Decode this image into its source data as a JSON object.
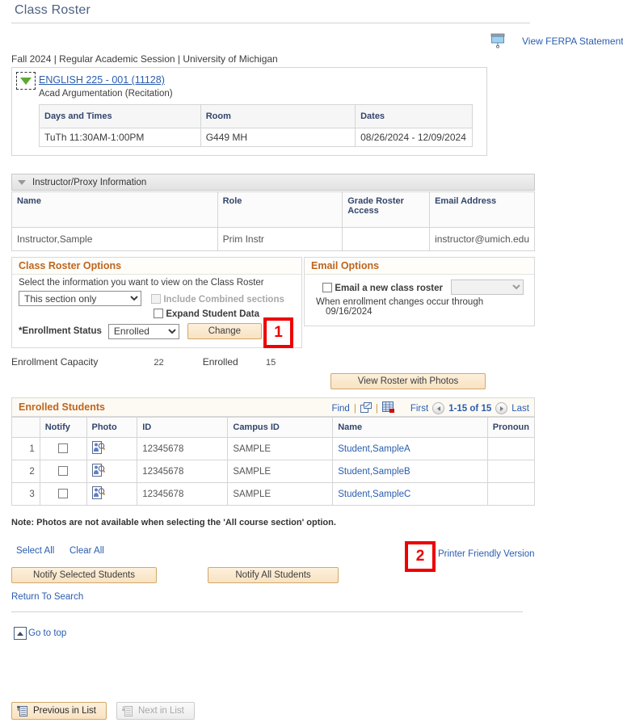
{
  "page": {
    "title": "Class Roster"
  },
  "ferpa": {
    "icon": "projector-screen-icon",
    "link_label": "View FERPA Statement"
  },
  "term_line": "Fall 2024 | Regular Academic Session | University of Michigan",
  "class": {
    "expand_icon": "collapse-triangle-icon",
    "link": "ENGLISH 225 - 001 (11128)",
    "subtitle": "Acad Argumentation (Recitation)",
    "meeting_headers": [
      "Days and Times",
      "Room",
      "Dates"
    ],
    "meeting_row": [
      "TuTh 11:30AM-1:00PM",
      "G449 MH",
      "08/26/2024 - 12/09/2024"
    ]
  },
  "instructor_section": {
    "header": "Instructor/Proxy Information",
    "columns": [
      "Name",
      "Role",
      "Grade Roster Access",
      "Email Address"
    ],
    "column_grade_line1": "Grade Roster",
    "column_grade_line2": "Access",
    "rows": [
      {
        "name": "Instructor,Sample",
        "role": "Prim Instr",
        "grade_roster_access": "",
        "email": "instructor@umich.edu"
      }
    ]
  },
  "roster_options": {
    "header": "Class Roster Options",
    "instruction": "Select the information you want to view on the Class Roster",
    "section_select_value": "This section only",
    "section_select_options": [
      "This section only"
    ],
    "include_combined_label": "Include Combined sections",
    "include_combined_checked": false,
    "include_combined_disabled": true,
    "expand_student_data_label": "Expand Student Data",
    "expand_student_data_checked": false,
    "enrollment_status_label": "*Enrollment Status",
    "enrollment_status_value": "Enrolled",
    "enrollment_status_options": [
      "Enrolled"
    ],
    "change_button": "Change"
  },
  "email_options": {
    "header": "Email Options",
    "checkbox_label": "Email a new class roster",
    "checkbox_checked": false,
    "select_value": "",
    "note_line1": "When enrollment changes occur through",
    "note_line2": "09/16/2024"
  },
  "enrollment": {
    "capacity_label": "Enrollment Capacity",
    "capacity_value": "22",
    "enrolled_label": "Enrolled",
    "enrolled_value": "15",
    "view_photos_button": "View Roster with Photos"
  },
  "students_grid": {
    "title": "Enrolled Students",
    "find_label": "Find",
    "view_all_icon": "open-new-window-icon",
    "download_icon": "download-to-excel-grid-icon",
    "first_label": "First",
    "prev_icon": "previous-arrow-icon",
    "range_label": "1-15 of 15",
    "next_icon": "next-arrow-icon",
    "last_label": "Last",
    "columns": [
      "",
      "Notify",
      "Photo",
      "ID",
      "Campus ID",
      "Name",
      "Pronoun"
    ],
    "rows": [
      {
        "index": "1",
        "notify_checked": false,
        "photo_icon": "student-photo-icon",
        "id": "12345678",
        "campus_id": "SAMPLE",
        "name": "Student,SampleA",
        "pronoun": ""
      },
      {
        "index": "2",
        "notify_checked": false,
        "photo_icon": "student-photo-icon",
        "id": "12345678",
        "campus_id": "SAMPLE",
        "name": "Student,SampleB",
        "pronoun": ""
      },
      {
        "index": "3",
        "notify_checked": false,
        "photo_icon": "student-photo-icon",
        "id": "12345678",
        "campus_id": "SAMPLE",
        "name": "Student,SampleC",
        "pronoun": ""
      }
    ]
  },
  "footer": {
    "note": "Note: Photos are not available when selecting the 'All course section' option.",
    "select_all": "Select All",
    "clear_all": "Clear All",
    "printer_friendly": "Printer Friendly Version",
    "notify_selected": "Notify Selected Students",
    "notify_all": "Notify All Students",
    "return_to_search": "Return To Search",
    "go_to_top": "Go to top",
    "go_to_top_icon": "go-to-top-icon",
    "previous_in_list": "Previous in List",
    "previous_icon": "previous-in-list-icon",
    "next_in_list": "Next in List",
    "next_icon": "next-in-list-icon",
    "next_disabled": true
  },
  "annotations": [
    {
      "label": "1",
      "target": "change-button"
    },
    {
      "label": "2",
      "target": "printer-friendly-version-link"
    }
  ],
  "colors": {
    "accent_orange": "#bf651d",
    "link_blue": "#2a5db0",
    "title_blue": "#4d6181",
    "annotation_red": "#ee0000",
    "button_tan": "#f8e2c2"
  }
}
